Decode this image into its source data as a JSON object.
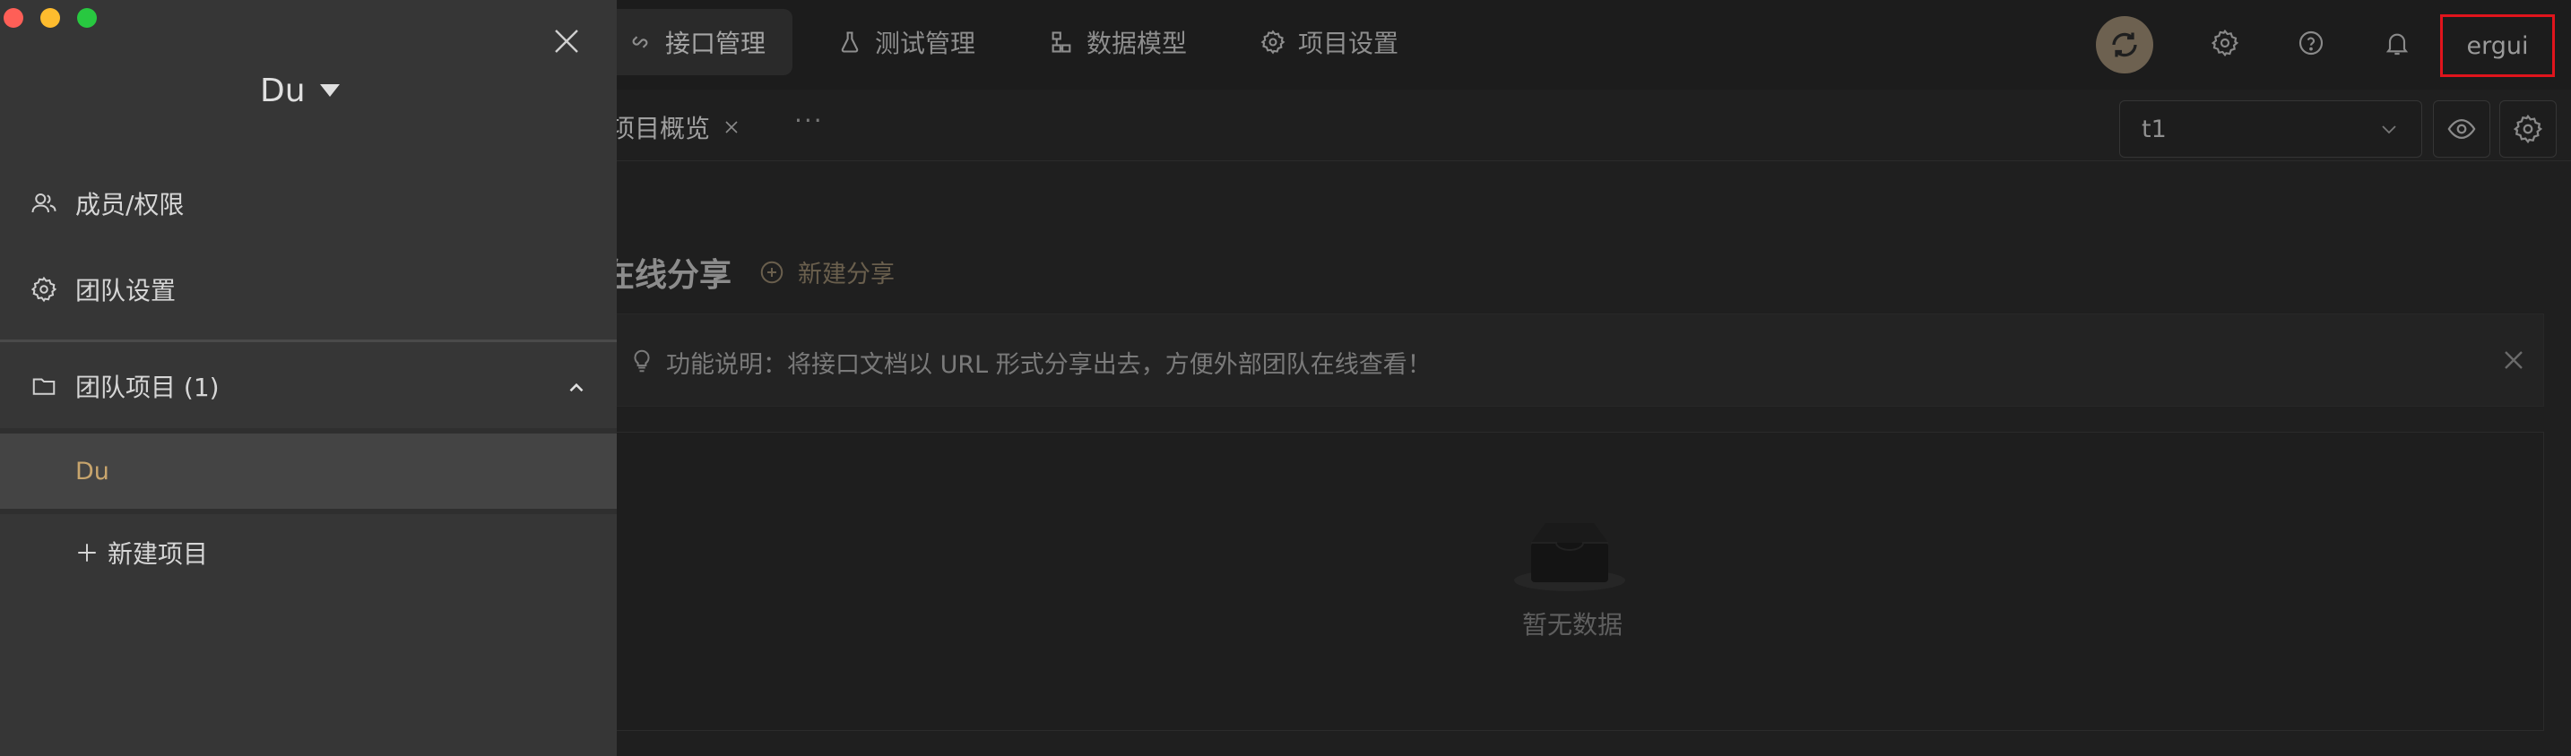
{
  "colors": {
    "drawer_bg": "#363636",
    "app_bg": "#1f1f1f",
    "accent_gold": "#c8a56d",
    "highlight_red": "#e0141c",
    "traffic_red": "#fe5f57",
    "traffic_yellow": "#febc2e",
    "traffic_green": "#28c840"
  },
  "window_controls": [
    "close",
    "minimize",
    "zoom"
  ],
  "drawer": {
    "team_name": "Du",
    "team_dropdown_icon": "caret-down-icon",
    "close_icon": "close-icon",
    "menu": [
      {
        "label": "成员/权限",
        "icon": "members-icon"
      },
      {
        "label": "团队设置",
        "icon": "gear-icon"
      }
    ],
    "projects_group": {
      "label": "团队项目 (1)",
      "icon": "folder-icon",
      "expanded": true
    },
    "projects": [
      {
        "name": "Du",
        "selected": true
      }
    ],
    "new_project_label": "新建项目"
  },
  "topnav": {
    "tabs": [
      {
        "label": "接口管理",
        "icon": "api-icon",
        "active": true
      },
      {
        "label": "测试管理",
        "icon": "flask-icon",
        "active": false
      },
      {
        "label": "数据模型",
        "icon": "model-icon",
        "active": false
      },
      {
        "label": "项目设置",
        "icon": "gear-icon",
        "active": false
      }
    ],
    "right_icons": [
      "sync-icon",
      "gear-icon",
      "help-icon",
      "bell-icon"
    ],
    "user_name": "ergui"
  },
  "subbar": {
    "open_tab": "项目概览",
    "more": "···",
    "environment": "t1"
  },
  "content": {
    "section_title": "在线分享",
    "new_share_label": "新建分享",
    "info_text": "功能说明：将接口文档以 URL 形式分享出去，方便外部团队在线查看！",
    "empty_text": "暂无数据"
  }
}
